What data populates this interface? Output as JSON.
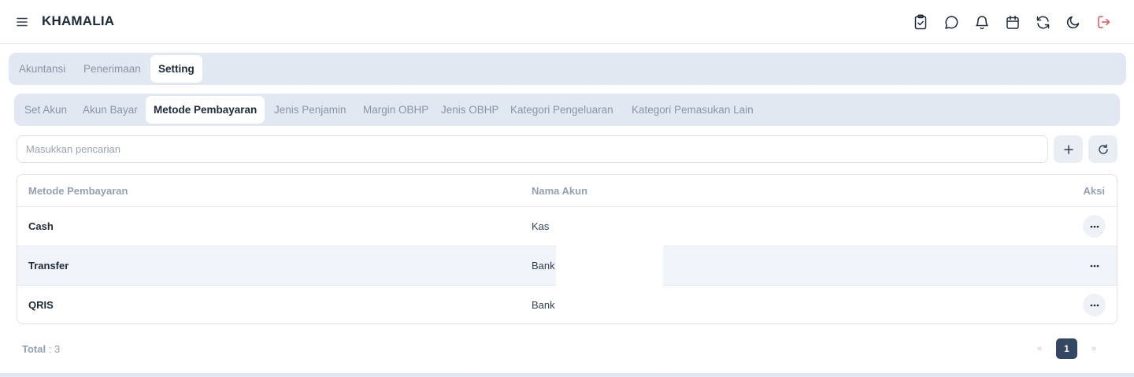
{
  "app": {
    "title": "KHAMALIA"
  },
  "header_icons": [
    "clipboard-check-icon",
    "chat-bubble-icon",
    "bell-icon",
    "calendar-icon",
    "refresh-icon",
    "moon-icon",
    "logout-icon"
  ],
  "main_tabs": [
    {
      "label": "Akuntansi",
      "active": false
    },
    {
      "label": "Penerimaan",
      "active": false
    },
    {
      "label": "Setting",
      "active": true
    }
  ],
  "sub_tabs": [
    {
      "label": "Set Akun",
      "active": false
    },
    {
      "label": "Akun Bayar",
      "active": false
    },
    {
      "label": "Metode Pembayaran",
      "active": true
    },
    {
      "label": "Jenis Penjamin",
      "active": false
    },
    {
      "label": "Margin OBHP",
      "active": false
    },
    {
      "label": "Jenis OBHP",
      "active": false
    },
    {
      "label": "Kategori Pengeluaran",
      "active": false
    },
    {
      "label": "Kategori Pemasukan Lain",
      "active": false
    }
  ],
  "search": {
    "placeholder": "Masukkan pencarian",
    "value": ""
  },
  "table": {
    "columns": [
      "Metode Pembayaran",
      "Nama Akun",
      "Aksi"
    ],
    "rows": [
      {
        "metode": "Cash",
        "akun": "Kas"
      },
      {
        "metode": "Transfer",
        "akun": "Bank"
      },
      {
        "metode": "QRIS",
        "akun": "Bank"
      }
    ]
  },
  "footer": {
    "total_label": "Total",
    "total_value": ": 3"
  },
  "pagination": {
    "prev": "«",
    "current": "1",
    "next": "»"
  },
  "colors": {
    "accent": "#334762",
    "tab_bg": "#e2e8f2",
    "logout": "#e05555"
  }
}
